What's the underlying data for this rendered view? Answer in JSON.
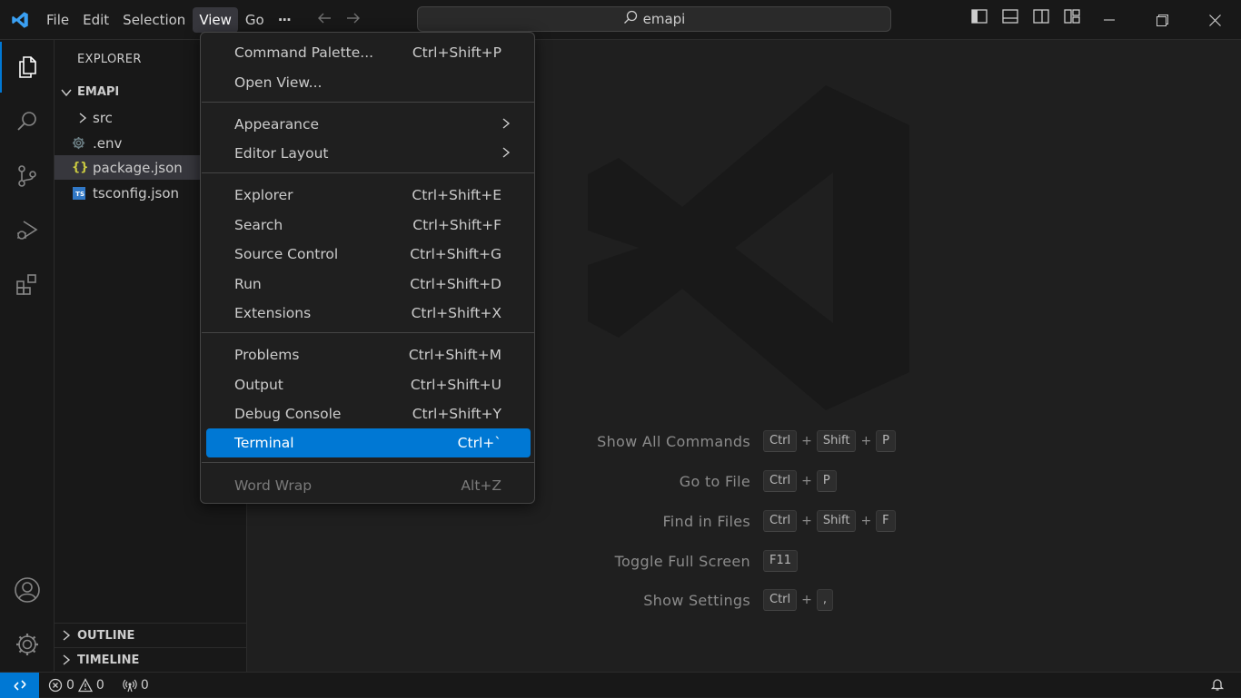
{
  "menubar": {
    "items": [
      "File",
      "Edit",
      "Selection",
      "View",
      "Go"
    ],
    "more": "···"
  },
  "search": {
    "text": "emapi"
  },
  "sidebar": {
    "title": "EXPLORER",
    "root": "EMAPI",
    "items": [
      {
        "label": "src",
        "type": "folder"
      },
      {
        "label": ".env",
        "type": "env"
      },
      {
        "label": "package.json",
        "type": "json"
      },
      {
        "label": "tsconfig.json",
        "type": "ts"
      }
    ],
    "ts_badge": "TS",
    "json_badge": "{}",
    "outline": "OUTLINE",
    "timeline": "TIMELINE"
  },
  "view_menu": {
    "items": [
      {
        "label": "Command Palette...",
        "shortcut": "Ctrl+Shift+P"
      },
      {
        "label": "Open View...",
        "shortcut": ""
      },
      {
        "label": "Appearance",
        "shortcut": ""
      },
      {
        "label": "Editor Layout",
        "shortcut": ""
      },
      {
        "label": "Explorer",
        "shortcut": "Ctrl+Shift+E"
      },
      {
        "label": "Search",
        "shortcut": "Ctrl+Shift+F"
      },
      {
        "label": "Source Control",
        "shortcut": "Ctrl+Shift+G"
      },
      {
        "label": "Run",
        "shortcut": "Ctrl+Shift+D"
      },
      {
        "label": "Extensions",
        "shortcut": "Ctrl+Shift+X"
      },
      {
        "label": "Problems",
        "shortcut": "Ctrl+Shift+M"
      },
      {
        "label": "Output",
        "shortcut": "Ctrl+Shift+U"
      },
      {
        "label": "Debug Console",
        "shortcut": "Ctrl+Shift+Y"
      },
      {
        "label": "Terminal",
        "shortcut": "Ctrl+`"
      },
      {
        "label": "Word Wrap",
        "shortcut": "Alt+Z"
      }
    ]
  },
  "welcome": {
    "shortcuts": [
      {
        "label": "Show All Commands",
        "keys": [
          "Ctrl",
          "Shift",
          "P"
        ]
      },
      {
        "label": "Go to File",
        "keys": [
          "Ctrl",
          "P"
        ]
      },
      {
        "label": "Find in Files",
        "keys": [
          "Ctrl",
          "Shift",
          "F"
        ]
      },
      {
        "label": "Toggle Full Screen",
        "keys": [
          "F11"
        ]
      },
      {
        "label": "Show Settings",
        "keys": [
          "Ctrl",
          ","
        ]
      }
    ],
    "plus": "+"
  },
  "status": {
    "errors": "0",
    "warnings": "0",
    "ports": "0"
  },
  "colors": {
    "accent": "#0078d4",
    "highlight": "#0078d4"
  }
}
